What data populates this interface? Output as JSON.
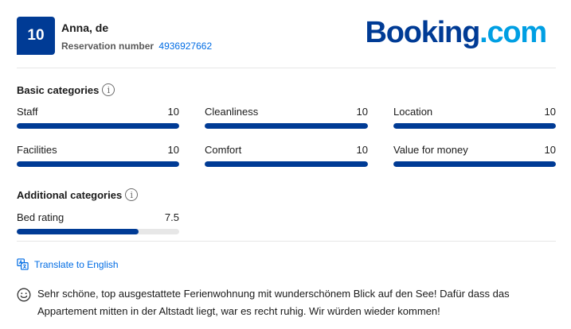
{
  "header": {
    "score": "10",
    "guest_name": "Anna, de",
    "reservation_label": "Reservation number",
    "reservation_number": "4936927662",
    "logo_part1": "Booking",
    "logo_part2": ".com"
  },
  "basic": {
    "title": "Basic categories",
    "categories": [
      {
        "label": "Staff",
        "value": "10",
        "fraction": 1.0
      },
      {
        "label": "Cleanliness",
        "value": "10",
        "fraction": 1.0
      },
      {
        "label": "Location",
        "value": "10",
        "fraction": 1.0
      },
      {
        "label": "Facilities",
        "value": "10",
        "fraction": 1.0
      },
      {
        "label": "Comfort",
        "value": "10",
        "fraction": 1.0
      },
      {
        "label": "Value for money",
        "value": "10",
        "fraction": 1.0
      }
    ]
  },
  "additional": {
    "title": "Additional categories",
    "categories": [
      {
        "label": "Bed rating",
        "value": "7.5",
        "fraction": 0.75
      }
    ]
  },
  "translate_label": "Translate to English",
  "review_text": "Sehr schöne, top ausgestattete Ferienwohnung mit wunderschönem Blick auf den See! Dafür dass das Appartement mitten in der Altstadt liegt, war es recht ruhig. Wir würden wieder kommen!",
  "colors": {
    "brand_dark": "#003b95",
    "brand_light": "#009fe3",
    "link": "#006ce4"
  },
  "icons": {
    "info": "info-icon",
    "translate": "translate-icon",
    "review": "smile-icon"
  }
}
